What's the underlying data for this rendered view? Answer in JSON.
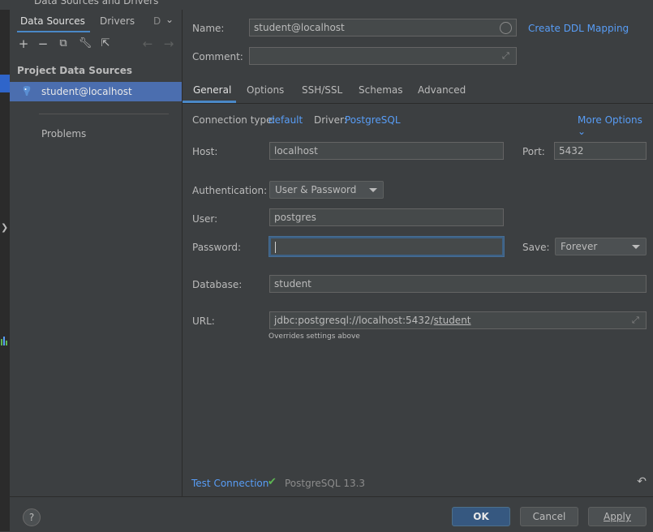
{
  "window": {
    "title": "Data Sources and Drivers"
  },
  "sidebar": {
    "tabs": {
      "data_sources": "Data Sources",
      "drivers": "Drivers",
      "more": "D"
    },
    "section_title": "Project Data Sources",
    "items": [
      {
        "label": "student@localhost"
      }
    ],
    "problems": "Problems"
  },
  "header": {
    "name_label": "Name:",
    "name_value": "student@localhost",
    "comment_label": "Comment:",
    "comment_value": "",
    "ddl_link": "Create DDL Mapping"
  },
  "tabs": [
    "General",
    "Options",
    "SSH/SSL",
    "Schemas",
    "Advanced"
  ],
  "general": {
    "connection_type_label": "Connection type:",
    "connection_type_value": "default",
    "driver_label": "Driver:",
    "driver_value": "PostgreSQL",
    "more_options": "More Options",
    "host_label": "Host:",
    "host_value": "localhost",
    "port_label": "Port:",
    "port_value": "5432",
    "auth_label": "Authentication:",
    "auth_value": "User & Password",
    "user_label": "User:",
    "user_value": "postgres",
    "password_label": "Password:",
    "password_value": "",
    "save_label": "Save:",
    "save_value": "Forever",
    "database_label": "Database:",
    "database_value": "student",
    "url_label": "URL:",
    "url_prefix": "jdbc:postgresql://localhost:5432/",
    "url_db": "student",
    "url_hint": "Overrides settings above"
  },
  "footer": {
    "test_connection": "Test Connection",
    "status": "PostgreSQL 13.3"
  },
  "buttons": {
    "help": "?",
    "ok": "OK",
    "cancel": "Cancel",
    "apply": "Apply"
  },
  "colors": {
    "accent": "#589df6",
    "selection": "#4b6eaf",
    "ok_button": "#365880",
    "success": "#5db553"
  }
}
